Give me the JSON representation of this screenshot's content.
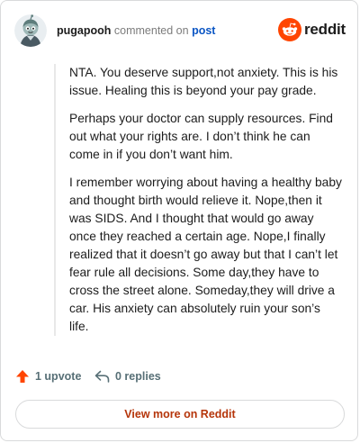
{
  "comment": {
    "username": "pugapooh",
    "verb": "commented on",
    "target": "post",
    "body": [
      "NTA. You deserve support,not anxiety. This is his issue. Healing this is beyond your pay grade.",
      "Perhaps your doctor can supply resources. Find out what your rights are. I don’t think he can come in if you don’t want him.",
      "I remember worrying about having a healthy baby and thought birth would relieve it. Nope,then it was SIDS. And I thought that would go away once they reached a certain age. Nope,I finally realized that it doesn’t go away but that I can’t let fear rule all decisions. Some day,they have to cross the street alone. Someday,they will drive a car. His anxiety can absolutely ruin your son’s life."
    ]
  },
  "brand": {
    "name": "reddit",
    "color": "#ff4500"
  },
  "actions": {
    "upvote_label": "1 upvote",
    "reply_label": "0 replies",
    "view_more_label": "View more on Reddit"
  },
  "icons": {
    "avatar": "avatar-icon",
    "upvote": "upvote-arrow-icon",
    "reply": "reply-arrow-icon",
    "brand": "reddit-snoo-icon"
  }
}
